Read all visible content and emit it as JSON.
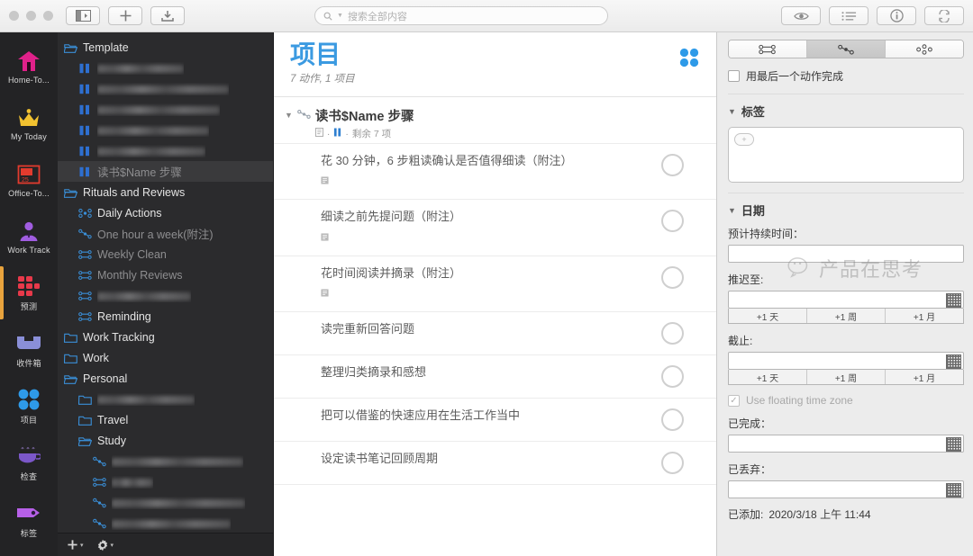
{
  "toolbar": {
    "window_buttons": [
      "close",
      "minimize",
      "zoom"
    ],
    "buttons": [
      {
        "name": "sidebar-toggle",
        "icon": "sidebar-icon"
      },
      {
        "name": "new-item",
        "icon": "plus-icon"
      },
      {
        "name": "inbox-capture",
        "icon": "inbox-download-icon"
      }
    ],
    "search": {
      "placeholder": "搜索全部内容",
      "value": "",
      "icon": "search-icon"
    },
    "right_buttons": [
      {
        "name": "view-options",
        "icon": "eye-icon"
      },
      {
        "name": "list-layout",
        "icon": "list-icon"
      },
      {
        "name": "inspector-toggle",
        "icon": "info-icon"
      },
      {
        "name": "sync",
        "icon": "sync-icon"
      }
    ]
  },
  "rail": {
    "items": [
      {
        "label": "Home-To...",
        "icon": "home-icon",
        "color": "#e0218a",
        "selected": false
      },
      {
        "label": "My Today",
        "icon": "crown-icon",
        "color": "#f2c230",
        "selected": false
      },
      {
        "label": "Office-To...",
        "icon": "office-calendar-icon",
        "color": "#e23b2e",
        "selected": false
      },
      {
        "label": "Work Track",
        "icon": "person-icon",
        "color": "#a05de0",
        "selected": false
      },
      {
        "label": "预测",
        "icon": "forecast-grid-icon",
        "color": "#e8394a",
        "selected": true
      },
      {
        "label": "收件箱",
        "icon": "inbox-tray-icon",
        "color": "#8a8fd8",
        "selected": false
      },
      {
        "label": "项目",
        "icon": "projects-dots-icon",
        "color": "#2e9ae8",
        "selected": false
      },
      {
        "label": "检查",
        "icon": "review-cup-icon",
        "color": "#7b57c9",
        "selected": false
      },
      {
        "label": "标签",
        "icon": "tag-icon",
        "color": "#b760e8",
        "selected": false
      }
    ]
  },
  "nav": {
    "rows": [
      {
        "label": "Template",
        "icon": "folder-open-icon",
        "indent": 0,
        "blurred": false,
        "dim": false,
        "selected": false
      },
      {
        "label": "",
        "icon": "project-paused-icon",
        "indent": 1,
        "blurred": true,
        "blur_width": 96,
        "dim": false,
        "selected": false
      },
      {
        "label": "",
        "icon": "project-paused-icon",
        "indent": 1,
        "blurred": true,
        "blur_width": 146,
        "dim": false,
        "selected": false
      },
      {
        "label": "",
        "icon": "project-paused-icon",
        "indent": 1,
        "blurred": true,
        "blur_width": 136,
        "dim": false,
        "selected": false
      },
      {
        "label": "",
        "icon": "project-paused-icon",
        "indent": 1,
        "blurred": true,
        "blur_width": 124,
        "dim": false,
        "selected": false
      },
      {
        "label": "",
        "icon": "project-paused-icon",
        "indent": 1,
        "blurred": true,
        "blur_width": 120,
        "dim": false,
        "selected": false
      },
      {
        "label": "读书$Name 步骤",
        "icon": "project-paused-icon",
        "indent": 1,
        "blurred": false,
        "dim": true,
        "selected": true
      },
      {
        "label": "Rituals and Reviews",
        "icon": "folder-open-icon",
        "indent": 0,
        "blurred": false,
        "dim": false,
        "selected": false
      },
      {
        "label": "Daily Actions",
        "icon": "project-parallel-icon",
        "indent": 1,
        "blurred": false,
        "dim": false,
        "selected": false
      },
      {
        "label": "One hour a week(附注)",
        "icon": "project-single-icon",
        "indent": 1,
        "blurred": false,
        "dim": true,
        "selected": false
      },
      {
        "label": "Weekly Clean",
        "icon": "project-sequential-icon",
        "indent": 1,
        "blurred": false,
        "dim": true,
        "selected": false
      },
      {
        "label": "Monthly Reviews",
        "icon": "project-sequential-icon",
        "indent": 1,
        "blurred": false,
        "dim": true,
        "selected": false
      },
      {
        "label": "",
        "icon": "project-sequential-icon",
        "indent": 1,
        "blurred": true,
        "blur_width": 104,
        "dim": true,
        "selected": false
      },
      {
        "label": "Reminding",
        "icon": "project-sequential-icon",
        "indent": 1,
        "blurred": false,
        "dim": false,
        "selected": false
      },
      {
        "label": "Work Tracking",
        "icon": "folder-icon",
        "indent": 0,
        "blurred": false,
        "dim": false,
        "selected": false
      },
      {
        "label": "Work",
        "icon": "folder-icon",
        "indent": 0,
        "blurred": false,
        "dim": false,
        "selected": false
      },
      {
        "label": "Personal",
        "icon": "folder-open-icon",
        "indent": 0,
        "blurred": false,
        "dim": false,
        "selected": false
      },
      {
        "label": "",
        "icon": "folder-icon",
        "indent": 1,
        "blurred": true,
        "blur_width": 108,
        "dim": false,
        "selected": false
      },
      {
        "label": "Travel",
        "icon": "folder-icon",
        "indent": 1,
        "blurred": false,
        "dim": false,
        "selected": false
      },
      {
        "label": "Study",
        "icon": "folder-open-icon",
        "indent": 1,
        "blurred": false,
        "dim": false,
        "selected": false
      },
      {
        "label": "",
        "icon": "project-single-icon",
        "indent": 2,
        "blurred": true,
        "blur_width": 146,
        "dim": false,
        "selected": false
      },
      {
        "label": "",
        "icon": "project-sequential-icon",
        "indent": 2,
        "blurred": true,
        "blur_width": 46,
        "dim": false,
        "selected": false
      },
      {
        "label": "",
        "icon": "project-single-icon",
        "indent": 2,
        "blurred": true,
        "blur_width": 148,
        "dim": false,
        "selected": false
      },
      {
        "label": "",
        "icon": "project-single-icon",
        "indent": 2,
        "blurred": true,
        "blur_width": 132,
        "dim": false,
        "selected": false
      }
    ],
    "footer": [
      {
        "name": "add-button",
        "icon": "plus-icon",
        "caret": "▾"
      },
      {
        "name": "settings-button",
        "icon": "gear-icon",
        "caret": "▾"
      }
    ]
  },
  "content": {
    "title": "项目",
    "subtitle": "7 动作, 1 项目",
    "header_icon": "projects-dots-icon",
    "group": {
      "title": "读书$Name 步骤",
      "icon": "project-single-icon",
      "disclosure": "▼",
      "meta_note_icon": "note-icon",
      "meta_status_icon": "paused-icon",
      "meta_text": "剩余 7 项",
      "meta_sep": "·"
    },
    "tasks": [
      {
        "title": "花 30 分钟，6 步粗读确认是否值得细读（附注）",
        "has_note": true
      },
      {
        "title": "细读之前先提问题（附注）",
        "has_note": true
      },
      {
        "title": "花时间阅读并摘录（附注）",
        "has_note": true
      },
      {
        "title": "读完重新回答问题",
        "has_note": false
      },
      {
        "title": "整理归类摘录和感想",
        "has_note": false
      },
      {
        "title": "把可以借鉴的快速应用在生活工作当中",
        "has_note": false
      },
      {
        "title": "设定读书笔记回顾周期",
        "has_note": false
      }
    ]
  },
  "inspector": {
    "segments": [
      {
        "name": "parallel",
        "icon": "project-parallel-icon",
        "selected": false
      },
      {
        "name": "sequential",
        "icon": "project-sequential-icon",
        "selected": true
      },
      {
        "name": "single-actions",
        "icon": "project-single-icon",
        "selected": false
      }
    ],
    "complete_with_last_action": {
      "label": "用最后一个动作完成",
      "checked": false
    },
    "tags": {
      "section": "标签",
      "add_label": "+",
      "values": []
    },
    "dates": {
      "section": "日期",
      "estimated_duration": {
        "label": "预计持续时间：",
        "value": ""
      },
      "defer": {
        "label": "推迟至:",
        "value": "",
        "steps": [
          "+1 天",
          "+1 周",
          "+1 月"
        ]
      },
      "due": {
        "label": "截止:",
        "value": "",
        "steps": [
          "+1 天",
          "+1 周",
          "+1 月"
        ]
      },
      "floating_time_zone": {
        "label": "Use floating time zone",
        "checked": true
      },
      "completed": {
        "label": "已完成：",
        "value": ""
      },
      "dropped": {
        "label": "已丢弃：",
        "value": ""
      },
      "added": {
        "label": "已添加:",
        "value": "2020/3/18 上午 11:44"
      }
    }
  },
  "watermark": {
    "text": "产品在思考",
    "icon": "wechat-icon"
  }
}
